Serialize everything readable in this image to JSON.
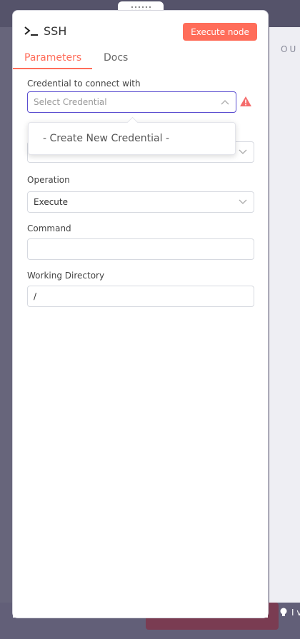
{
  "node": {
    "title": "SSH",
    "execute_label": "Execute node"
  },
  "tabs": [
    {
      "label": "Parameters"
    },
    {
      "label": "Docs"
    }
  ],
  "credential": {
    "label": "Credential to connect with",
    "placeholder": "Select Credential",
    "dropdown_option": "- Create New Credential -"
  },
  "operation": {
    "label": "Operation",
    "value": "Execute"
  },
  "command": {
    "label": "Command",
    "value": ""
  },
  "working_directory": {
    "label": "Working Directory",
    "value": "/"
  },
  "background": {
    "output_label": "OU",
    "bottom_text": "I v"
  },
  "colors": {
    "accent": "#ff6d5a",
    "focus": "#5b4ed0",
    "warning": "#f56c6c"
  }
}
